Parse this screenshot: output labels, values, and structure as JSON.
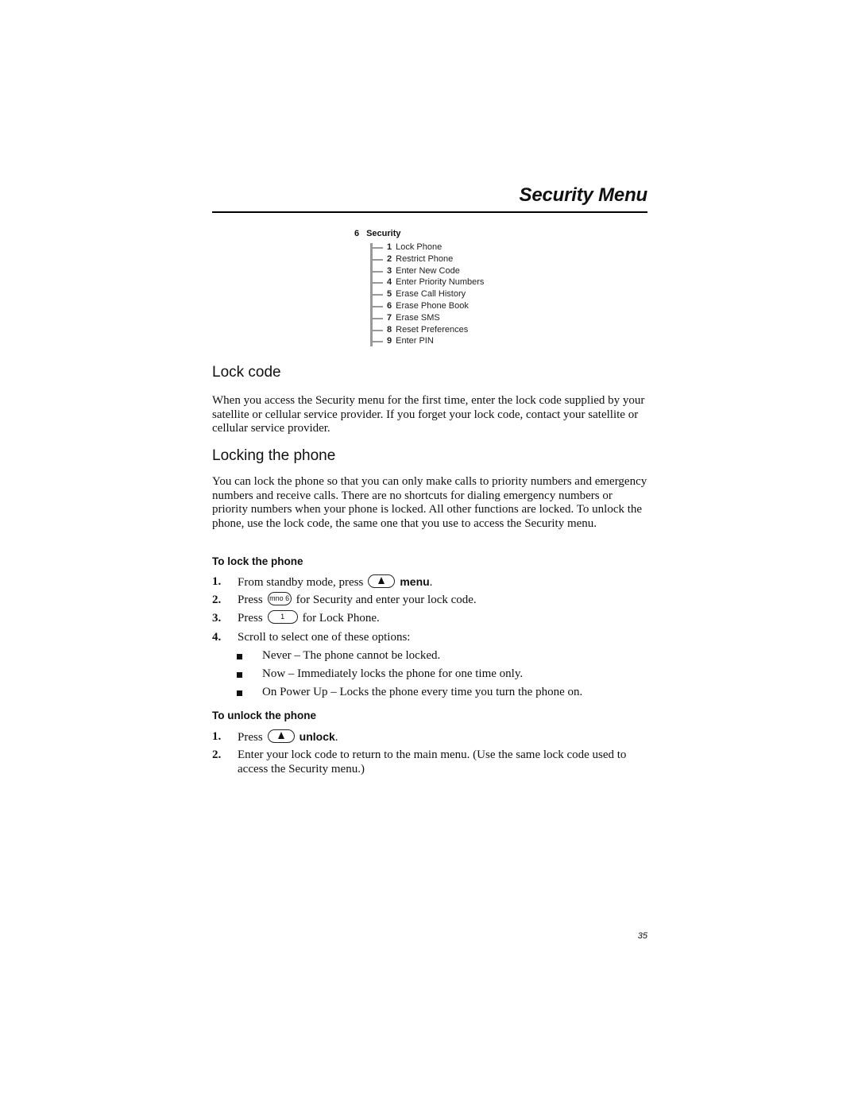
{
  "header": {
    "title": "Security Menu"
  },
  "menu_tree": {
    "root_number": "6",
    "root_label": "Security",
    "items": [
      {
        "number": "1",
        "label": "Lock Phone"
      },
      {
        "number": "2",
        "label": "Restrict Phone"
      },
      {
        "number": "3",
        "label": "Enter New Code"
      },
      {
        "number": "4",
        "label": "Enter Priority Numbers"
      },
      {
        "number": "5",
        "label": "Erase Call History"
      },
      {
        "number": "6",
        "label": "Erase Phone Book"
      },
      {
        "number": "7",
        "label": "Erase SMS"
      },
      {
        "number": "8",
        "label": "Reset Preferences"
      },
      {
        "number": "9",
        "label": "Enter PIN"
      }
    ]
  },
  "lock_code": {
    "heading": "Lock code",
    "body": "When you access the Security menu for the first time, enter the lock code supplied by your satellite or cellular service provider. If you forget your lock code, contact your satellite or cellular service provider."
  },
  "locking": {
    "heading": "Locking the phone",
    "body": "You can lock the phone so that you can only make calls to priority numbers and emergency numbers and receive calls. There are no shortcuts for dialing emergency numbers or priority numbers when your phone is locked. All other functions are locked. To unlock the phone, use the lock code, the same one that you use to access the Security menu."
  },
  "to_lock": {
    "heading": "To lock the phone",
    "steps": [
      {
        "n": "1.",
        "before": "From standby mode, press",
        "key": "nav-up",
        "softkey": "menu",
        "after": "."
      },
      {
        "n": "2.",
        "before": "Press",
        "key": "mno 6",
        "after": "for Security and enter your lock code."
      },
      {
        "n": "3.",
        "before": "Press",
        "key": "1",
        "after": "for Lock Phone."
      },
      {
        "n": "4.",
        "text": "Scroll to select one of these options:"
      }
    ],
    "options": [
      "Never – The phone cannot be locked.",
      "Now – Immediately locks the phone for one time only.",
      "On Power Up – Locks the phone every time you turn the phone on."
    ]
  },
  "to_unlock": {
    "heading": "To unlock the phone",
    "steps": [
      {
        "n": "1.",
        "before": "Press",
        "key": "nav-up",
        "softkey": "unlock",
        "after": "."
      },
      {
        "n": "2.",
        "text": "Enter your lock code to return to the main menu. (Use the same lock code used to access the Security menu.)"
      }
    ]
  },
  "footer": {
    "page_number": "35"
  }
}
